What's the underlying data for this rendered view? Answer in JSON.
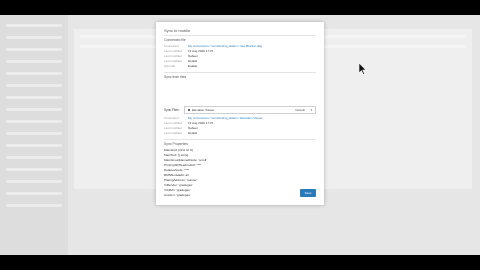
{
  "modal": {
    "title": "Sync to mobile",
    "save_label": "Save"
  },
  "connected": {
    "title": "Connected file",
    "rows": [
      {
        "key": "Connected",
        "value": "My connections / Contributing_Elders / Get-Blocker.dwg",
        "link": true
      },
      {
        "key": "Last modified",
        "value": "13 Aug 2020 17:37",
        "link": false
      },
      {
        "key": "Last modified",
        "value": "Nabeel",
        "link": false
      },
      {
        "key": "Last modified",
        "value": "Details",
        "link": false
      },
      {
        "key": "Sync file",
        "value": "Enable",
        "link": false
      }
    ]
  },
  "sync": {
    "title": "Sync from files",
    "label": "Sync Files",
    "selected": "Elevation Viewer",
    "right_text": "Default",
    "caret": "▾",
    "rows": [
      {
        "key": "Connected",
        "value": "My connections / Contributing_Elders / Elevation Viewer",
        "link": true
      },
      {
        "key": "Last modified",
        "value": "13 Aug 2020 17:37",
        "link": false
      },
      {
        "key": "Last modified",
        "value": "Nabeel",
        "link": false
      },
      {
        "key": "Last modified",
        "value": "Details",
        "link": false
      }
    ]
  },
  "props": {
    "title": "Sync Properties",
    "items": [
      "MainGrid: [Grid Id: #]",
      "MainText: [[ string",
      "MainGroupNamedNode: 'scroll'",
      "PrintingSRHeadnode#: ****",
      "RelativeNode: ****",
      "RMNNodeEdit: all",
      "PlatingAddress: 'pointer'",
      "ViRender: 'gradegas'",
      "ViAtlMn: 'gradegas'",
      "Autofen: 'gradegas'"
    ]
  },
  "colors": {
    "accent": "#2b7bb9",
    "overlay": "#e6e6e6"
  }
}
